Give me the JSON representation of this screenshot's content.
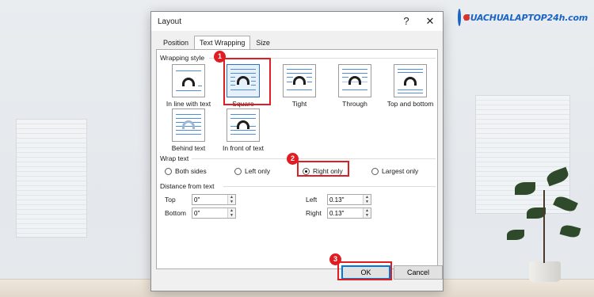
{
  "dialog": {
    "title": "Layout",
    "help_label": "?",
    "close_label": "✕"
  },
  "tabs": [
    "Position",
    "Text Wrapping",
    "Size"
  ],
  "wrapping_style": {
    "heading": "Wrapping style",
    "options": [
      "In line with text",
      "Square",
      "Tight",
      "Through",
      "Top and bottom",
      "Behind text",
      "In front of text"
    ],
    "selected": "Square"
  },
  "wrap_text": {
    "heading": "Wrap text",
    "options": [
      "Both sides",
      "Left only",
      "Right only",
      "Largest only"
    ],
    "selected": "Right only"
  },
  "distance": {
    "heading": "Distance from text",
    "top_label": "Top",
    "top_value": "0\"",
    "bottom_label": "Bottom",
    "bottom_value": "0\"",
    "left_label": "Left",
    "left_value": "0.13\"",
    "right_label": "Right",
    "right_value": "0.13\""
  },
  "buttons": {
    "ok": "OK",
    "cancel": "Cancel"
  },
  "steps": [
    "1",
    "2",
    "3"
  ],
  "brand": {
    "text": "SUACHUALAPTOP24h.com",
    "color": "#1a64c2"
  },
  "colors": {
    "highlight": "#e11d24",
    "accent": "#0078d7"
  }
}
